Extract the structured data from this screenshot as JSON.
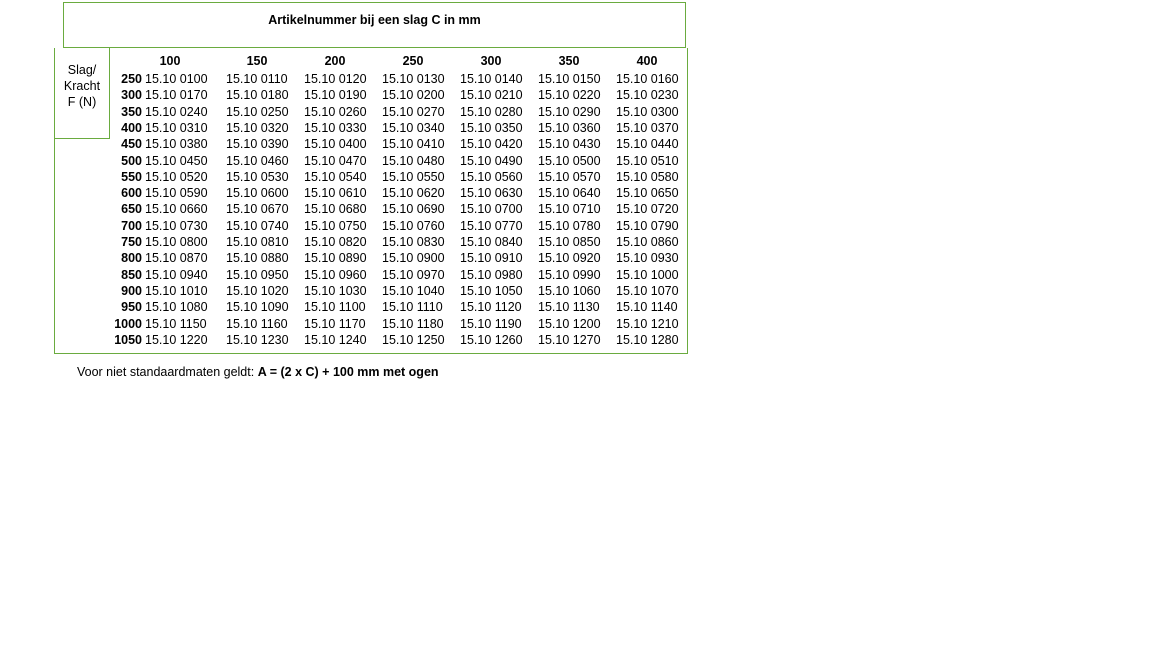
{
  "title": "Artikelnummer bij een slag C in mm",
  "corner_label": [
    "Slag/",
    "Kracht",
    "F (N)"
  ],
  "columns": [
    "100",
    "150",
    "200",
    "250",
    "300",
    "350",
    "400"
  ],
  "rows": [
    {
      "force": "250",
      "cells": [
        "15.10 0100",
        "15.10 0110",
        "15.10 0120",
        "15.10 0130",
        "15.10 0140",
        "15.10 0150",
        "15.10 0160"
      ]
    },
    {
      "force": "300",
      "cells": [
        "15.10 0170",
        "15.10 0180",
        "15.10 0190",
        "15.10 0200",
        "15.10 0210",
        "15.10 0220",
        "15.10 0230"
      ]
    },
    {
      "force": "350",
      "cells": [
        "15.10 0240",
        "15.10 0250",
        "15.10 0260",
        "15.10 0270",
        "15.10 0280",
        "15.10 0290",
        "15.10 0300"
      ]
    },
    {
      "force": "400",
      "cells": [
        "15.10 0310",
        "15.10 0320",
        "15.10 0330",
        "15.10 0340",
        "15.10 0350",
        "15.10 0360",
        "15.10 0370"
      ]
    },
    {
      "force": "450",
      "cells": [
        "15.10 0380",
        "15.10 0390",
        "15.10 0400",
        "15.10 0410",
        "15.10 0420",
        "15.10 0430",
        "15.10 0440"
      ]
    },
    {
      "force": "500",
      "cells": [
        "15.10 0450",
        "15.10 0460",
        "15.10 0470",
        "15.10 0480",
        "15.10 0490",
        "15.10 0500",
        "15.10 0510"
      ]
    },
    {
      "force": "550",
      "cells": [
        "15.10 0520",
        "15.10 0530",
        "15.10 0540",
        "15.10 0550",
        "15.10 0560",
        "15.10 0570",
        "15.10 0580"
      ]
    },
    {
      "force": "600",
      "cells": [
        "15.10 0590",
        "15.10 0600",
        "15.10 0610",
        "15.10 0620",
        "15.10 0630",
        "15.10 0640",
        "15.10 0650"
      ]
    },
    {
      "force": "650",
      "cells": [
        "15.10 0660",
        "15.10 0670",
        "15.10 0680",
        "15.10 0690",
        "15.10 0700",
        "15.10 0710",
        "15.10 0720"
      ]
    },
    {
      "force": "700",
      "cells": [
        "15.10 0730",
        "15.10 0740",
        "15.10 0750",
        "15.10 0760",
        "15.10 0770",
        "15.10 0780",
        "15.10 0790"
      ]
    },
    {
      "force": "750",
      "cells": [
        "15.10 0800",
        "15.10 0810",
        "15.10 0820",
        "15.10 0830",
        "15.10 0840",
        "15.10 0850",
        "15.10 0860"
      ]
    },
    {
      "force": "800",
      "cells": [
        "15.10 0870",
        "15.10 0880",
        "15.10 0890",
        "15.10 0900",
        "15.10 0910",
        "15.10 0920",
        "15.10 0930"
      ]
    },
    {
      "force": "850",
      "cells": [
        "15.10 0940",
        "15.10 0950",
        "15.10 0960",
        "15.10 0970",
        "15.10 0980",
        "15.10 0990",
        "15.10 1000"
      ]
    },
    {
      "force": "900",
      "cells": [
        "15.10 1010",
        "15.10 1020",
        "15.10 1030",
        "15.10 1040",
        "15.10 1050",
        "15.10 1060",
        "15.10 1070"
      ]
    },
    {
      "force": "950",
      "cells": [
        "15.10 1080",
        "15.10 1090",
        "15.10 1100",
        "15.10 1110",
        "15.10 1120",
        "15.10 1130",
        "15.10 1140"
      ]
    },
    {
      "force": "1000",
      "cells": [
        "15.10 1150",
        "15.10 1160",
        "15.10 1170",
        "15.10 1180",
        "15.10 1190",
        "15.10 1200",
        "15.10 1210"
      ]
    },
    {
      "force": "1050",
      "cells": [
        "15.10 1220",
        "15.10 1230",
        "15.10 1240",
        "15.10 1250",
        "15.10 1260",
        "15.10 1270",
        "15.10 1280"
      ]
    }
  ],
  "note": {
    "prefix": "Voor niet standaardmaten geldt: ",
    "formula": "A = (2 x C) + 100 mm met ogen"
  },
  "colors": {
    "border": "#6aab3f"
  }
}
